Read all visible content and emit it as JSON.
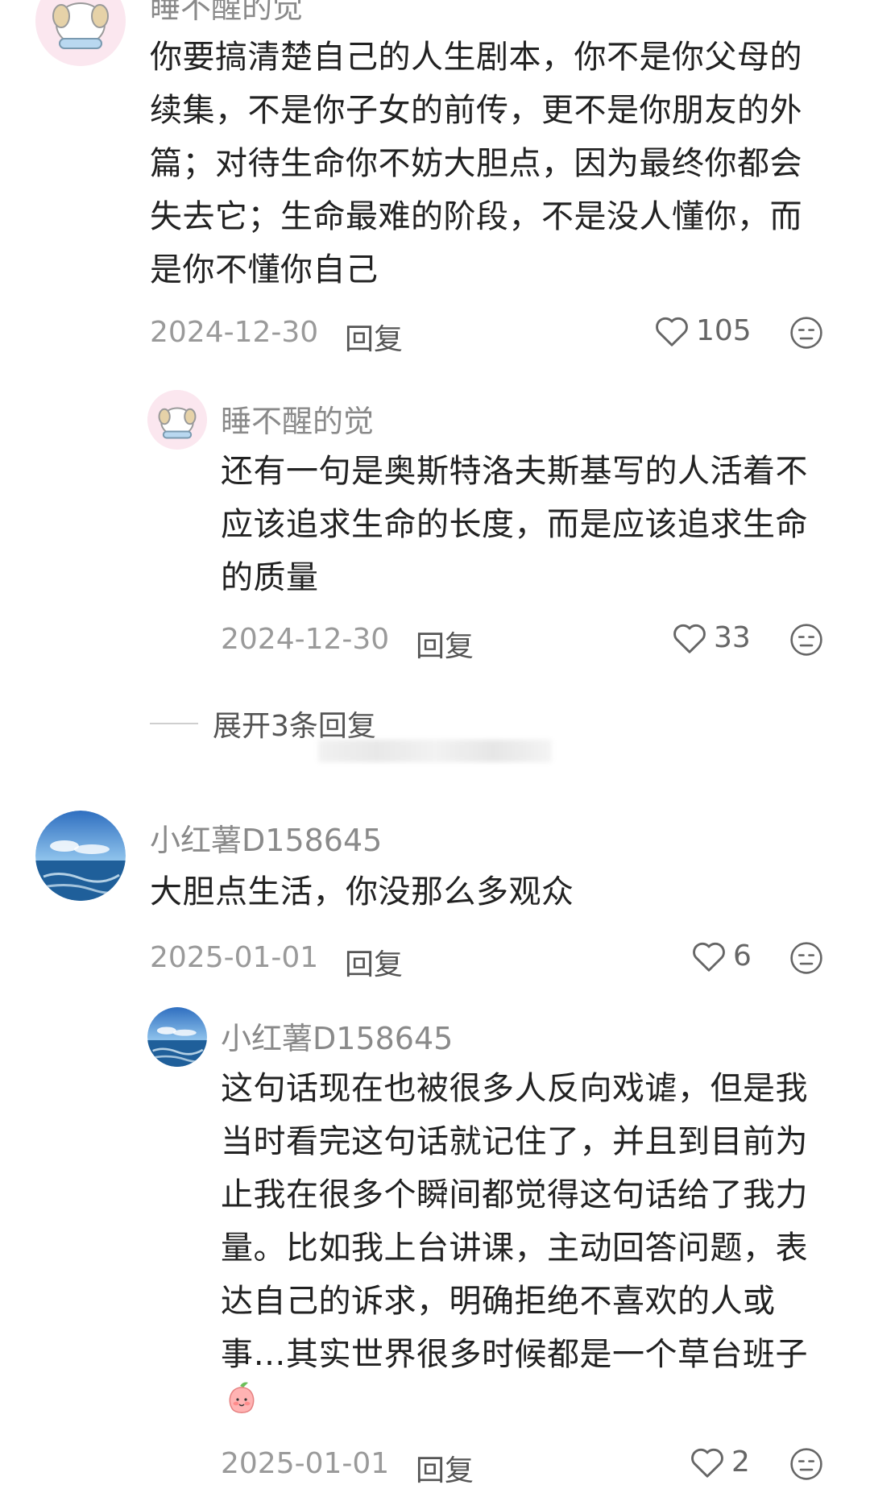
{
  "comments": [
    {
      "author": "睡不醒的觉",
      "lines": [
        "你要搞清楚自己的人生剧本，你不是你父母的",
        "续集，不是你子女的前传，更不是你朋友的外",
        "篇；对待生命你不妨大胆点，因为最终你都会",
        "失去它；生命最难的阶段，不是没人懂你，而",
        "是你不懂你自己"
      ],
      "date": "2024-12-30",
      "reply_label": "回复",
      "likes": "105",
      "replies": [
        {
          "author": "睡不醒的觉",
          "lines": [
            "还有一句是奥斯特洛夫斯基写的人活着不",
            "应该追求生命的长度，而是应该追求生命",
            "的质量"
          ],
          "date": "2024-12-30",
          "reply_label": "回复",
          "likes": "33"
        }
      ],
      "expand_label": "展开3条回复"
    },
    {
      "author": "小红薯D158645",
      "lines": [
        "大胆点生活，你没那么多观众"
      ],
      "date": "2025-01-01",
      "reply_label": "回复",
      "likes": "6",
      "replies": [
        {
          "author": "小红薯D158645",
          "lines": [
            "这句话现在也被很多人反向戏谑，但是我",
            "当时看完这句话就记住了，并且到目前为",
            "止我在很多个瞬间都觉得这句话给了我力",
            "量。比如我上台讲课，主动回答问题，表",
            "达自己的诉求，明确拒绝不喜欢的人或",
            "事…其实世界很多时候都是一个草台班子"
          ],
          "date": "2025-01-01",
          "reply_label": "回复",
          "likes": "2"
        }
      ]
    }
  ],
  "icons": {
    "like": "heart-outline-icon",
    "dislike": "meh-face-icon",
    "emoji": "peach-emoji-icon"
  },
  "colors": {
    "text": "#222222",
    "meta": "#9a9a9a",
    "icon": "#666666"
  }
}
